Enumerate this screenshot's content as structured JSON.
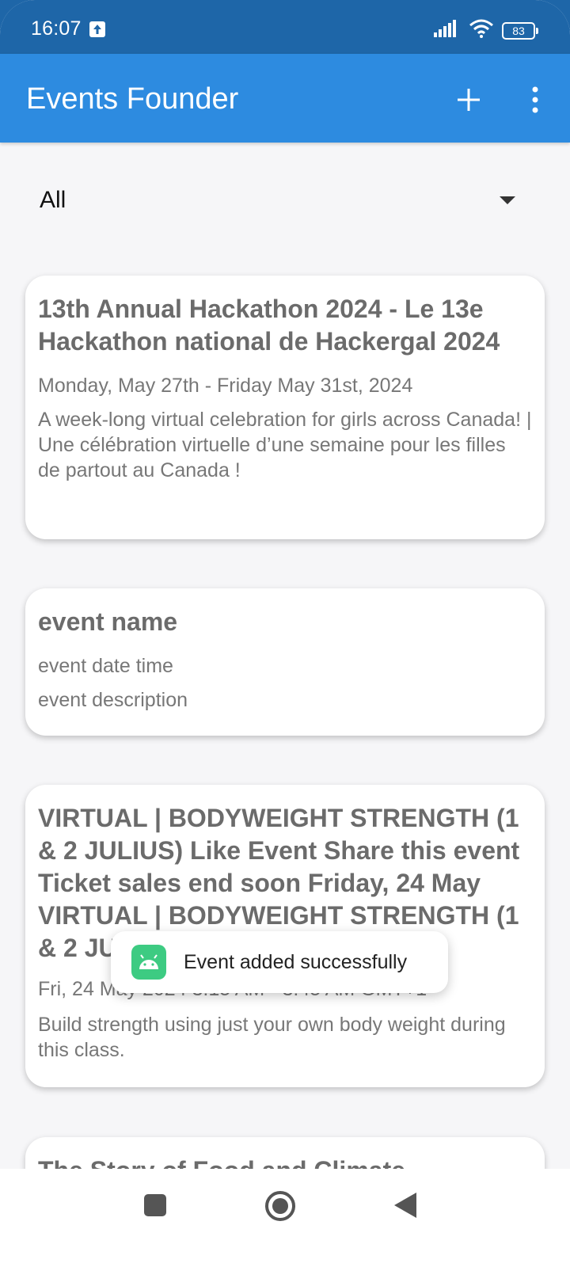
{
  "status_bar": {
    "time": "16:07",
    "battery": "83",
    "icons": [
      "upload-icon",
      "signal-icon",
      "wifi-icon",
      "battery-icon"
    ]
  },
  "app_bar": {
    "title": "Events Founder",
    "actions": [
      "add-icon",
      "more-vertical-icon"
    ]
  },
  "filter": {
    "selected": "All"
  },
  "events": [
    {
      "title": "13th Annual Hackathon 2024 - Le 13e Hackathon national de Hackergal 2024",
      "date": "Monday, May 27th - Friday May 31st, 2024",
      "description": "A week-long virtual celebration for girls across Canada! | Une célébration virtuelle d’une semaine pour les filles de partout au Canada !"
    },
    {
      "title": "event name",
      "date": "event date time",
      "description": "event description"
    },
    {
      "title": " VIRTUAL | BODYWEIGHT STRENGTH (1 & 2 JULIUS)  Like Event  Share this event Ticket sales end soon Friday, 24 May VIRTUAL | BODYWEIGHT STRENGTH (1 & 2 JULIUS)",
      "date": "Fri, 24 May 2024 3:15 AM - 3:45 AM GMT+1",
      "description": "Build strength using just your own body weight during this class."
    },
    {
      "title": "The Story of Food and Climate"
    }
  ],
  "toast": {
    "message": "Event added successfully",
    "icon": "android-icon"
  },
  "colors": {
    "status_bar": "#1e66a8",
    "app_bar": "#2d8be0",
    "background": "#f6f6f8",
    "card_title": "#6b6b6b",
    "card_text": "#777777",
    "toast_icon": "#3dcb82"
  }
}
